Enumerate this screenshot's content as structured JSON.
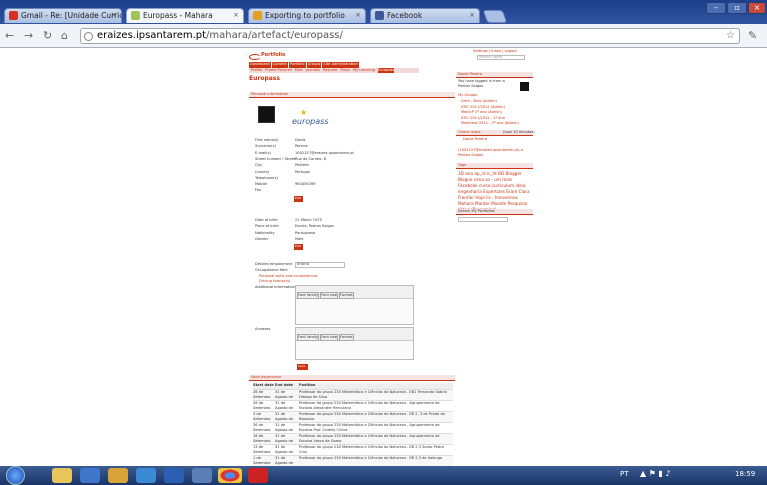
{
  "browser": {
    "tabs": [
      {
        "title": "Gmail - Re: [Unidade Curric",
        "color": "#d93025"
      },
      {
        "title": "Europass - Mahara",
        "color": "#a0c25a"
      },
      {
        "title": "Exporting to portfolio",
        "color": "#e0a020"
      },
      {
        "title": "Facebook",
        "color": "#3b5998"
      }
    ],
    "url_host": "eraizes.ipsantarem.pt",
    "url_path": "/mahara/artefact/europass/"
  },
  "site": {
    "logo": "Portfolio",
    "user_links": "Settings | Inbox | Logout",
    "search_placeholder": "Search users",
    "main_nav": [
      "Dashboard",
      "Content",
      "Portfolio",
      "Groups",
      "Site Administration"
    ],
    "sub_nav": [
      "Profile",
      "Profile Pictures",
      "Files",
      "Journals",
      "Resume",
      "Plans",
      "My Learning",
      "Europass"
    ],
    "page_title": "Europass",
    "section_personal": "Personal information",
    "europass_logo": "europass",
    "personal_fields": [
      {
        "label": "First name(s)",
        "value": "David"
      },
      {
        "label": "Surname(s)",
        "value": "Pereira"
      },
      {
        "label": "E-mail(s)",
        "value": "1002157@eraizes.ipsantarem.pt"
      },
      {
        "label": "Street number / Street",
        "value": "Rua do Correio, 8"
      },
      {
        "label": "City",
        "value": "Pedrete"
      },
      {
        "label": "Country",
        "value": "Portugal"
      },
      {
        "label": "Telephone(s)",
        "value": ""
      },
      {
        "label": "Mobile",
        "value": "963456789"
      },
      {
        "label": "Fax",
        "value": ""
      }
    ],
    "birth_fields": [
      {
        "label": "Date of birth",
        "value": "21 March 1975"
      },
      {
        "label": "Place of birth",
        "value": "Escola, Pedras Salgas"
      },
      {
        "label": "Nationality",
        "value": "Portuguese"
      },
      {
        "label": "Gender",
        "value": "Male"
      }
    ],
    "edit_label": "Edit",
    "desired_label": "Desired employment",
    "desired_value": "Ensino",
    "occupational_label": "Occupational field",
    "skills_links": [
      "Personal skills and competences",
      "Driving license(s)"
    ],
    "additional_label": "Additional information",
    "annexes_label": "Annexes",
    "editor_buttons": [
      "Font family",
      "Font size",
      "Format"
    ],
    "save_label": "Save",
    "work_section": "Work experience",
    "work_headers": [
      "Start date",
      "End date",
      "Position"
    ],
    "work_rows": [
      [
        "26 de Setembro de 2001",
        "31 de Agosto de 2002",
        "Professor do grupo 230 Matemática e Ciências da Natureza - EB1 Fernando Sobral Fidalgo de Silva"
      ],
      [
        "26 de Setembro de 2002",
        "31 de Agosto de 2003",
        "Professor do grupo 230 Matemática e Ciências da Natureza - Agrupamento de Escolas Alexandre Herculano"
      ],
      [
        "3 de Setembro de 2003",
        "31 de Agosto de 2004",
        "Professor do grupo 230 Matemática e Ciências da Natureza - EB 2, 3 de Prado do Repouso"
      ],
      [
        "26 de Setembro de 2004",
        "31 de Agosto de 2005",
        "Professor do grupo 230 Matemática e Ciências da Natureza - Agrupamento de Escolas Prof. Lindley Cintra"
      ],
      [
        "16 de Setembro de 2005",
        "31 de Agosto de 2006",
        "Professor do grupo 230 Matemática e Ciências da Natureza - Agrupamento de Escolas Vasco da Gama"
      ],
      [
        "13 de Setembro de 2006",
        "31 de Agosto de 2007",
        "Professor do grupo 230 Matemática e Ciências da Natureza - EB 2,3 Santo Pedro Cruz"
      ],
      [
        "1 de Setembro de 2007",
        "31 de Agosto de 2008",
        "Professor do grupo 230 Matemática e Ciências da Natureza - EB 2,3 de Valongo"
      ]
    ]
  },
  "sidebar": {
    "user_title": "David Pereira",
    "logged_text": "You have logged in from a Pedras Salgas",
    "groups_title": "My Groups",
    "groups": [
      "Urfm - Braz (Admin)",
      "ATIC 2011/2012 (Admin)",
      "MedicP 1º ano (Admin)",
      "ATIC 2011/2012 - 1º ano",
      "Mestrado 2011 - 2º ano (Admin)"
    ],
    "online_title": "Online users",
    "online_note": "(Last 10 minutes)",
    "online_users": [
      "David Pereira"
    ],
    "online_email": "(1002157@eraizes.ipsantarem.pt) a Pedras Salgas",
    "tags_title": "Tags",
    "tags": "3D ana ap_ct ic_ht BD Blogger Blogue cena so - um mais Facebook curso curriculum ideia engenharia Expertizes Eram Clara Frontier Hoje lis - Innovemos Mahara Manter Moodle Pesquisar Video (Processing)",
    "search_title": "Search My Portfolios"
  },
  "taskbar": {
    "lang": "PT",
    "time": "18:59"
  }
}
